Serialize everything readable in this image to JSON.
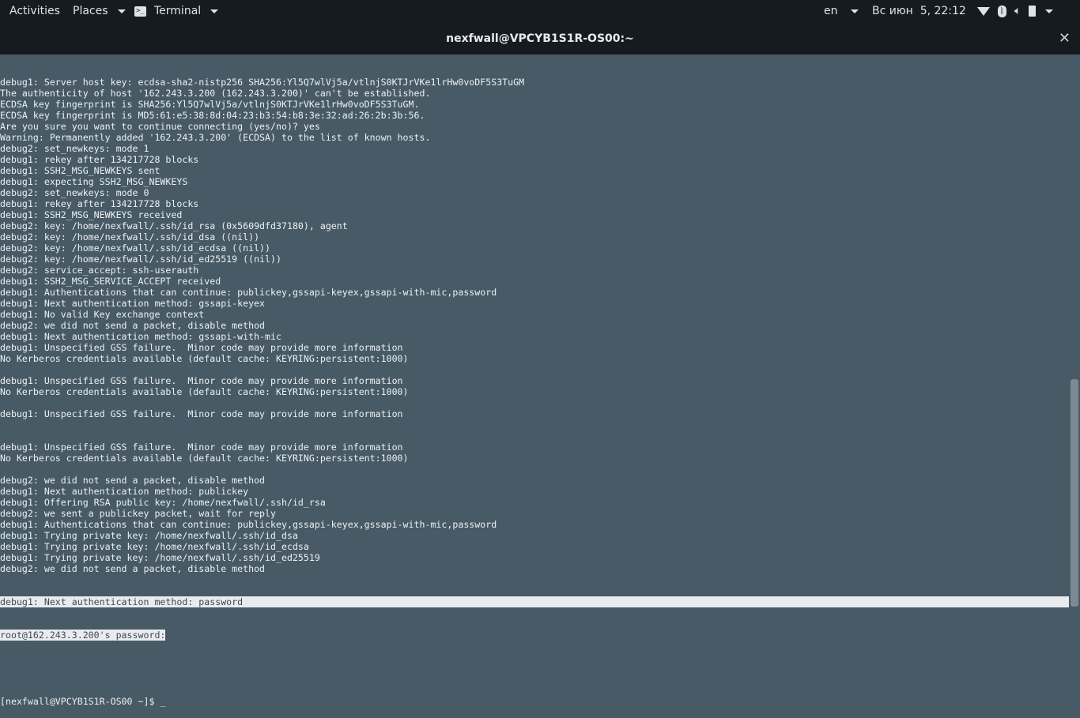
{
  "topbar": {
    "activities": "Activities",
    "places": "Places",
    "app": "Terminal",
    "lang": "en",
    "clock": "Вс июн  5, 22:12"
  },
  "window": {
    "title": "nexfwall@VPCYB1S1R-OS00:~"
  },
  "terminal": {
    "lines": [
      "debug1: Server host key: ecdsa-sha2-nistp256 SHA256:Yl5Q7wlVj5a/vtlnjS0KTJrVKe1lrHw0voDF5S3TuGM",
      "The authenticity of host '162.243.3.200 (162.243.3.200)' can't be established.",
      "ECDSA key fingerprint is SHA256:Yl5Q7wlVj5a/vtlnjS0KTJrVKe1lrHw0voDF5S3TuGM.",
      "ECDSA key fingerprint is MD5:61:e5:38:8d:04:23:b3:54:b8:3e:32:ad:26:2b:3b:56.",
      "Are you sure you want to continue connecting (yes/no)? yes",
      "Warning: Permanently added '162.243.3.200' (ECDSA) to the list of known hosts.",
      "debug2: set_newkeys: mode 1",
      "debug1: rekey after 134217728 blocks",
      "debug1: SSH2_MSG_NEWKEYS sent",
      "debug1: expecting SSH2_MSG_NEWKEYS",
      "debug2: set_newkeys: mode 0",
      "debug1: rekey after 134217728 blocks",
      "debug1: SSH2_MSG_NEWKEYS received",
      "debug2: key: /home/nexfwall/.ssh/id_rsa (0x5609dfd37180), agent",
      "debug2: key: /home/nexfwall/.ssh/id_dsa ((nil))",
      "debug2: key: /home/nexfwall/.ssh/id_ecdsa ((nil))",
      "debug2: key: /home/nexfwall/.ssh/id_ed25519 ((nil))",
      "debug2: service_accept: ssh-userauth",
      "debug1: SSH2_MSG_SERVICE_ACCEPT received",
      "debug1: Authentications that can continue: publickey,gssapi-keyex,gssapi-with-mic,password",
      "debug1: Next authentication method: gssapi-keyex",
      "debug1: No valid Key exchange context",
      "debug2: we did not send a packet, disable method",
      "debug1: Next authentication method: gssapi-with-mic",
      "debug1: Unspecified GSS failure.  Minor code may provide more information",
      "No Kerberos credentials available (default cache: KEYRING:persistent:1000)",
      "",
      "debug1: Unspecified GSS failure.  Minor code may provide more information",
      "No Kerberos credentials available (default cache: KEYRING:persistent:1000)",
      "",
      "debug1: Unspecified GSS failure.  Minor code may provide more information",
      "",
      "",
      "debug1: Unspecified GSS failure.  Minor code may provide more information",
      "No Kerberos credentials available (default cache: KEYRING:persistent:1000)",
      "",
      "debug2: we did not send a packet, disable method",
      "debug1: Next authentication method: publickey",
      "debug1: Offering RSA public key: /home/nexfwall/.ssh/id_rsa",
      "debug2: we sent a publickey packet, wait for reply",
      "debug1: Authentications that can continue: publickey,gssapi-keyex,gssapi-with-mic,password",
      "debug1: Trying private key: /home/nexfwall/.ssh/id_dsa",
      "debug1: Trying private key: /home/nexfwall/.ssh/id_ecdsa",
      "debug1: Trying private key: /home/nexfwall/.ssh/id_ed25519",
      "debug2: we did not send a packet, disable method"
    ],
    "selected_line": "debug1: Next authentication method: password",
    "password_prompt": "root@162.243.3.200's password:",
    "prompt": "[nexfwall@VPCYB1S1R-OS00 ~]$ ",
    "cursor": "_"
  }
}
